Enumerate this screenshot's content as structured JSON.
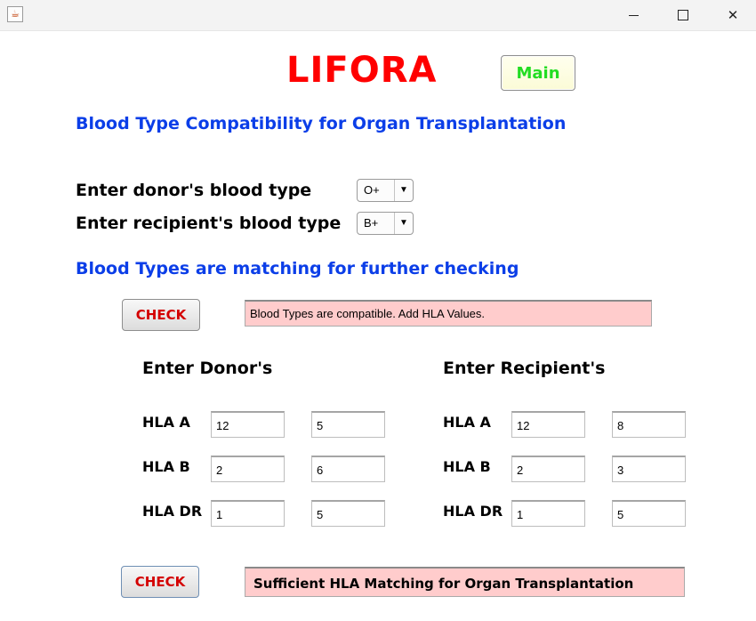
{
  "window": {
    "controls": {
      "minimize": "minimize",
      "maximize": "maximize",
      "close": "close"
    }
  },
  "header": {
    "app_name": "LIFORA",
    "main_button": "Main",
    "subtitle": "Blood Type Compatibility for Organ Transplantation"
  },
  "blood_type": {
    "donor_label": "Enter donor's blood type",
    "donor_value": "O+",
    "recipient_label": "Enter recipient's blood type",
    "recipient_value": "B+",
    "status_message": "Blood Types are matching for further checking"
  },
  "check1": {
    "button": "CHECK",
    "result": "Blood Types are compatible. Add HLA Values."
  },
  "donor": {
    "heading": "Enter Donor's",
    "hla_a_label": "HLA A",
    "hla_a_1": "12",
    "hla_a_2": "5",
    "hla_b_label": "HLA B",
    "hla_b_1": "2",
    "hla_b_2": "6",
    "hla_dr_label": "HLA DR",
    "hla_dr_1": "1",
    "hla_dr_2": "5"
  },
  "recipient": {
    "heading": "Enter Recipient's",
    "hla_a_label": "HLA A",
    "hla_a_1": "12",
    "hla_a_2": "8",
    "hla_b_label": "HLA B",
    "hla_b_1": "2",
    "hla_b_2": "3",
    "hla_dr_label": "HLA DR",
    "hla_dr_1": "1",
    "hla_dr_2": "5"
  },
  "check2": {
    "button": "CHECK",
    "result": "Sufficient HLA Matching for Organ Transplantation"
  },
  "colors": {
    "title": "#ff0000",
    "accent_blue": "#0b3ee8",
    "main_button_text": "#22dd22",
    "check_button_text": "#d40000",
    "result_background": "#ffcccc"
  }
}
